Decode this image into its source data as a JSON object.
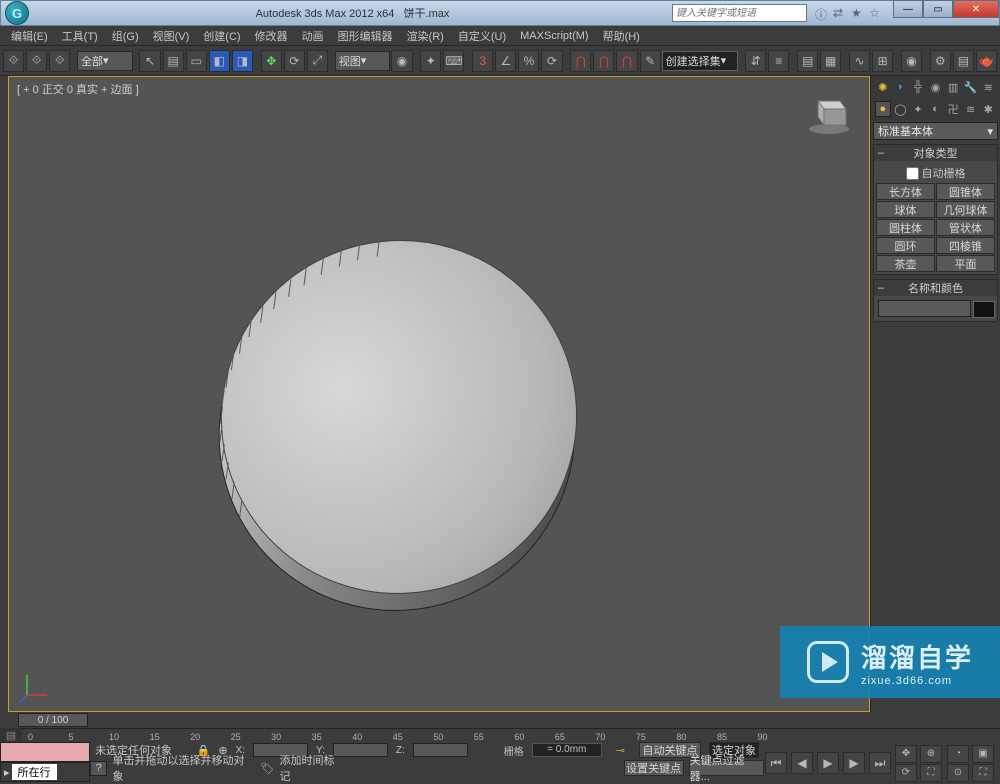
{
  "titlebar": {
    "app_name": "Autodesk 3ds Max 2012 x64",
    "file_name": "饼干.max",
    "search_placeholder": "键入关键字或短语"
  },
  "menubar": [
    "编辑(E)",
    "工具(T)",
    "组(G)",
    "视图(V)",
    "创建(C)",
    "修改器",
    "动画",
    "图形编辑器",
    "渲染(R)",
    "自定义(U)",
    "MAXScript(M)",
    "帮助(H)"
  ],
  "toolbar": {
    "dd_all": "全部",
    "dd_view": "视图",
    "selection_set_placeholder": "创建选择集"
  },
  "viewport": {
    "label": "[ + 0 正交 0 真实 + 边面 ]"
  },
  "cmdpanel": {
    "category_dd": "标准基本体",
    "rollup1_title": "对象类型",
    "autogrid_label": "自动栅格",
    "objects": [
      [
        "长方体",
        "圆锥体"
      ],
      [
        "球体",
        "几何球体"
      ],
      [
        "圆柱体",
        "管状体"
      ],
      [
        "圆环",
        "四棱锥"
      ],
      [
        "茶壶",
        "平面"
      ]
    ],
    "rollup2_title": "名称和颜色"
  },
  "timeline": {
    "slider_label": "0 / 100",
    "ticks": [
      0,
      5,
      10,
      15,
      20,
      25,
      30,
      35,
      40,
      45,
      50,
      55,
      60,
      65,
      70,
      75,
      80,
      85,
      90
    ]
  },
  "status": {
    "row2": "所在行",
    "prompt1": "未选定任何对象",
    "prompt2": "单击并拖动以选择并移动对象",
    "add_time_tag": "添加时间标记",
    "x_label": "X:",
    "y_label": "Y:",
    "z_label": "Z:",
    "grid_label": "栅格",
    "grid_value": "= 0.0mm",
    "autokey": "自动关键点",
    "selected": "选定对象",
    "setkey": "设置关键点",
    "key_filter": "关键点过滤器..."
  },
  "watermark": {
    "title": "溜溜自学",
    "url": "zixue.3d66.com"
  }
}
